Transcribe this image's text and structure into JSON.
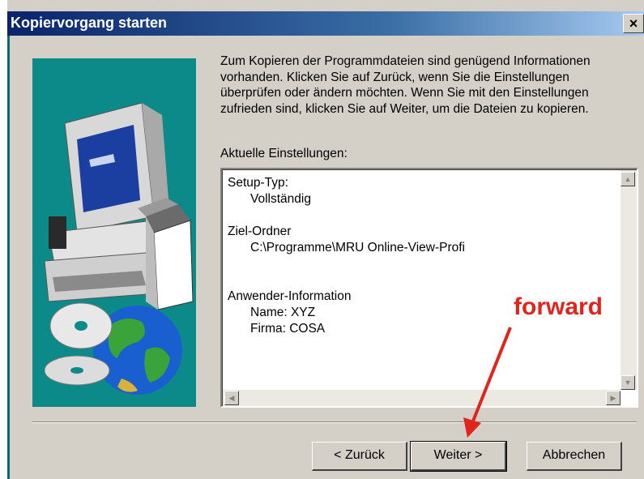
{
  "window": {
    "title": "Kopiervorgang starten",
    "close_label": "×"
  },
  "intro_text": "Zum Kopieren der Programmdateien sind genügend Informationen vorhanden. Klicken Sie auf Zurück, wenn Sie die Einstellungen überprüfen oder ändern möchten. Wenn Sie mit den Einstellungen zufrieden sind, klicken Sie auf Weiter, um die Dateien zu kopieren.",
  "current_settings_label": "Aktuelle Einstellungen:",
  "settings": {
    "setup_type_label": "Setup-Typ:",
    "setup_type_value": "Vollständig",
    "target_folder_label": "Ziel-Ordner",
    "target_folder_value": "C:\\Programme\\MRU Online-View-Profi",
    "user_info_label": "Anwender-Information",
    "name_line": "Name:  XYZ",
    "company_line": "Firma:  COSA"
  },
  "buttons": {
    "back": "< Zurück",
    "next": "Weiter >",
    "cancel": "Abbrechen"
  },
  "annotation": {
    "text": "forward",
    "color": "#e0251d"
  },
  "colors": {
    "titlebar_start": "#0a246a",
    "titlebar_end": "#a6caf0",
    "panel": "#0c8a8a",
    "dialog_bg": "#d4d0c8"
  },
  "icons": [
    "computer-icon",
    "globe-icon",
    "cd-icon",
    "box-icon"
  ]
}
